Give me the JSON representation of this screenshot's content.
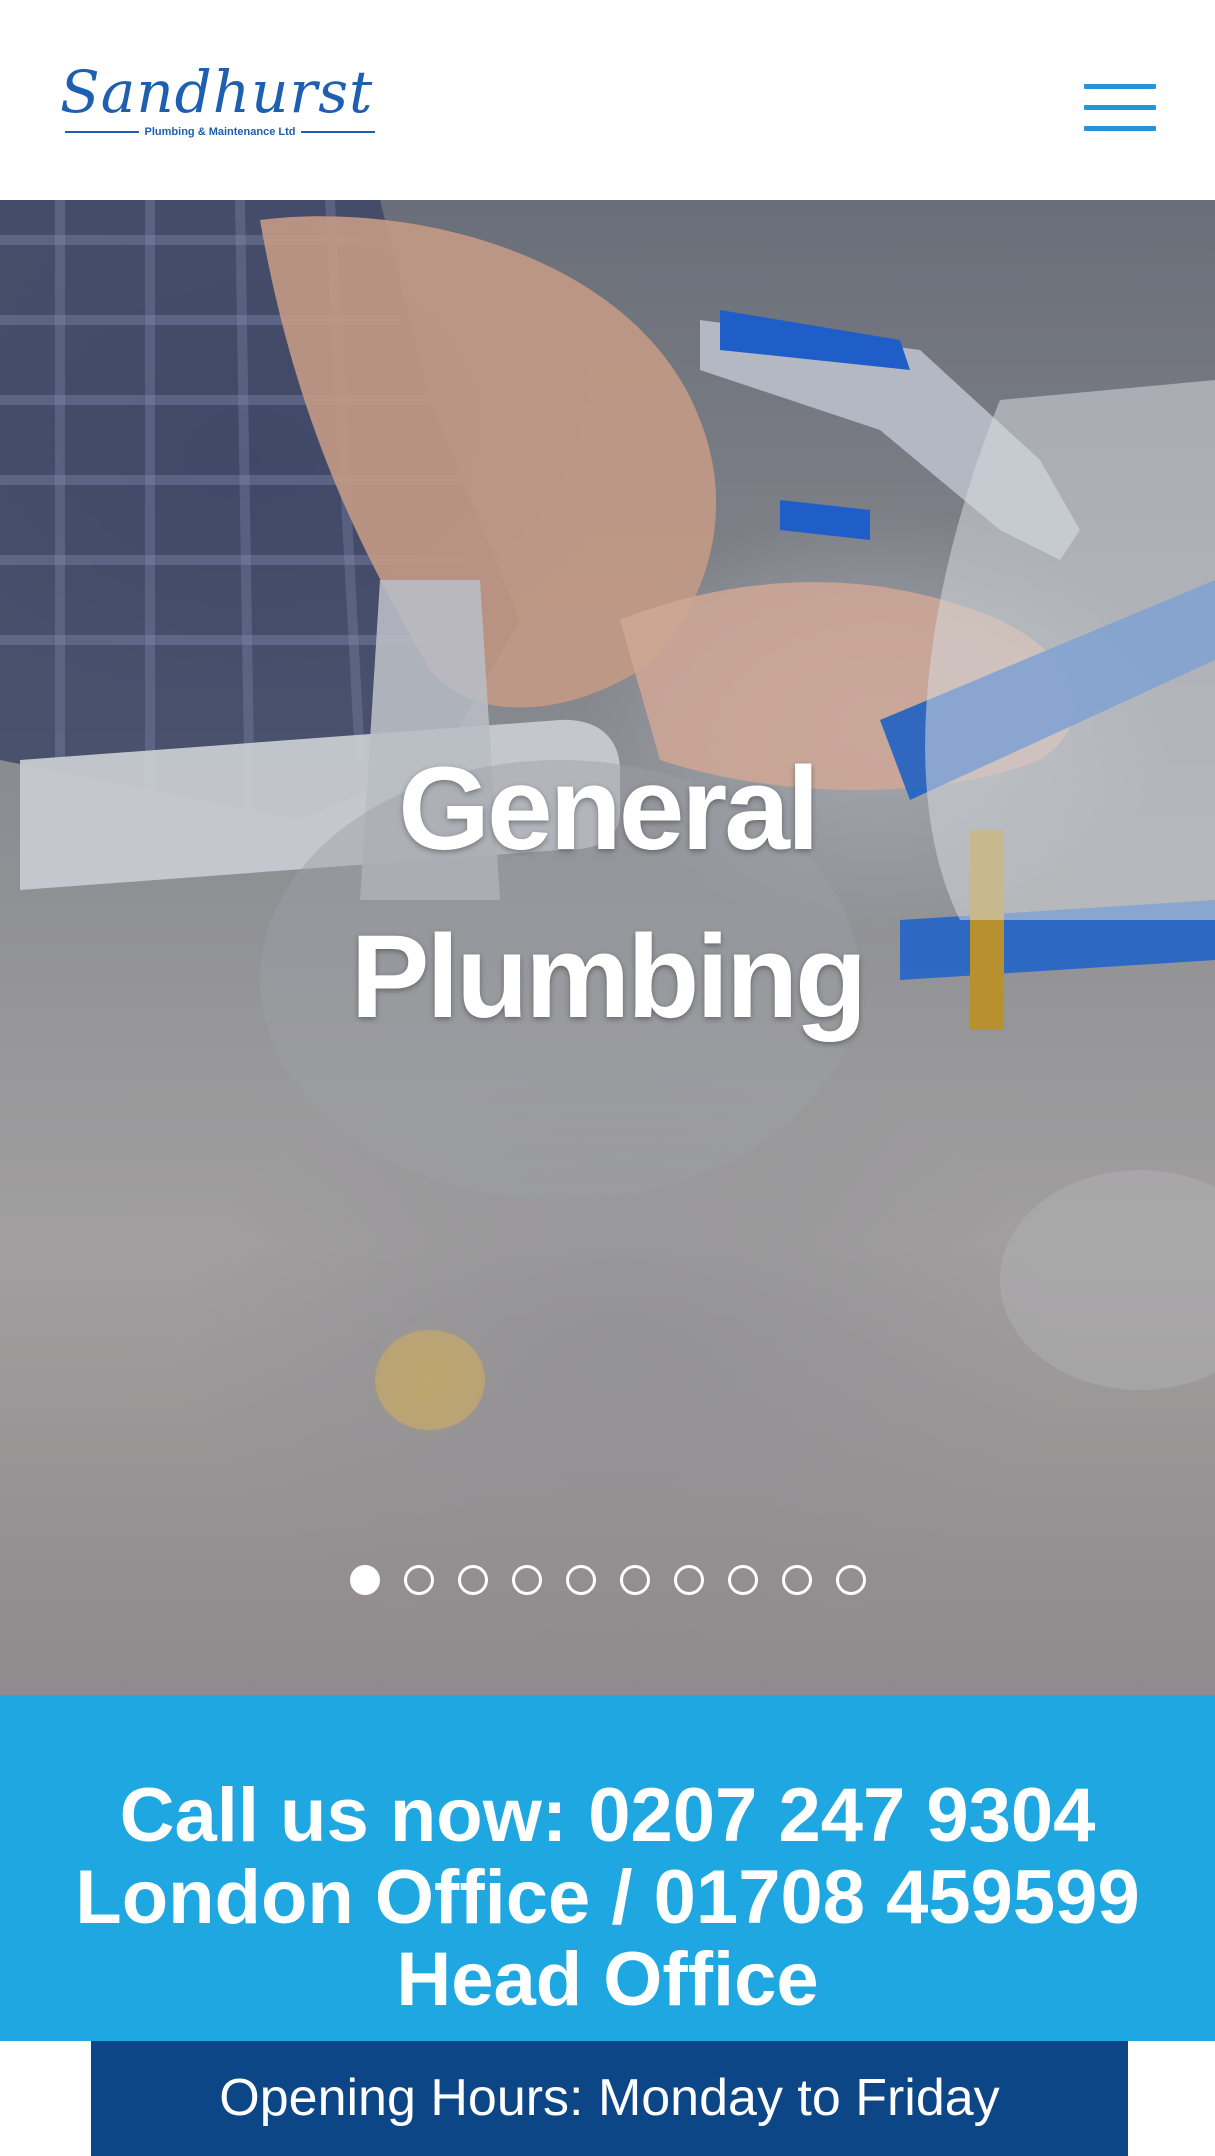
{
  "header": {
    "logo_name": "Sandhurst",
    "logo_tagline": "Plumbing & Maintenance Ltd",
    "menu_icon": "hamburger-menu-icon"
  },
  "hero": {
    "title_line1": "General",
    "title_line2": "Plumbing",
    "slides": {
      "total": 10,
      "active": 1
    }
  },
  "callbar": {
    "line1": "Call us now: 0207 247 9304",
    "line2": "London Office / 01708 459599",
    "line3": "Head Office"
  },
  "hours": {
    "text": "Opening Hours: Monday to Friday"
  },
  "colors": {
    "brand_blue": "#1f5fb0",
    "menu_blue": "#2694d8",
    "callbar_blue": "#1ea7e1",
    "hours_navy": "#0c4686"
  }
}
